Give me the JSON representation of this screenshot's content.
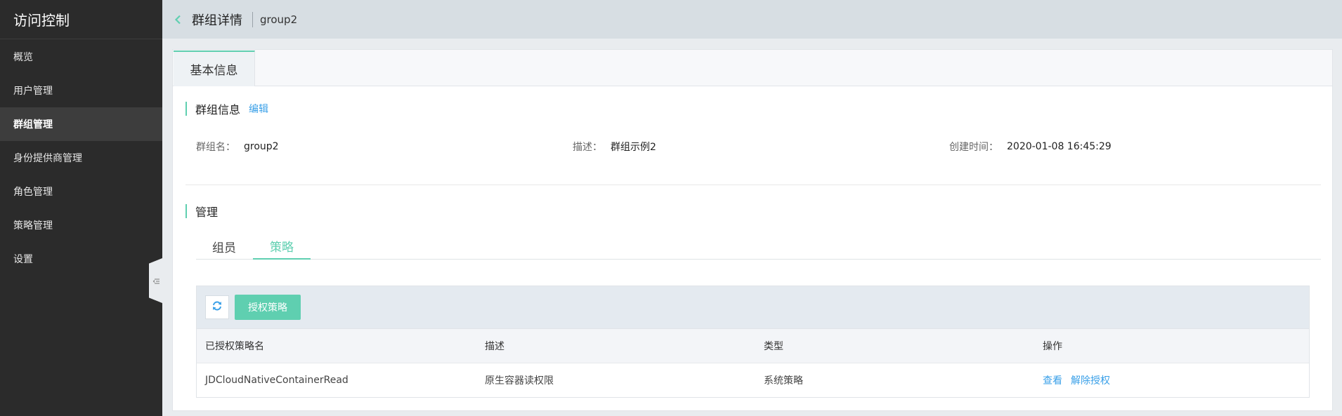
{
  "sidebar": {
    "title": "访问控制",
    "items": [
      {
        "label": "概览"
      },
      {
        "label": "用户管理"
      },
      {
        "label": "群组管理"
      },
      {
        "label": "身份提供商管理"
      },
      {
        "label": "角色管理"
      },
      {
        "label": "策略管理"
      },
      {
        "label": "设置"
      }
    ],
    "active_index": 2
  },
  "header": {
    "title": "群组详情",
    "subtitle": "group2"
  },
  "top_tabs": [
    {
      "label": "基本信息"
    }
  ],
  "group_info": {
    "section_title": "群组信息",
    "edit_label": "编辑",
    "name_label": "群组名：",
    "name_value": "group2",
    "desc_label": "描述：",
    "desc_value": "群组示例2",
    "created_label": "创建时间：",
    "created_value": "2020-01-08 16:45:29"
  },
  "manage": {
    "section_title": "管理",
    "tabs": [
      {
        "label": "组员"
      },
      {
        "label": "策略"
      }
    ],
    "active_tab": 1,
    "grant_button": "授权策略",
    "columns": [
      "已授权策略名",
      "描述",
      "类型",
      "操作"
    ],
    "rows": [
      {
        "name": "JDCloudNativeContainerRead",
        "desc": "原生容器读权限",
        "type": "系统策略",
        "actions": [
          "查看",
          "解除授权"
        ]
      }
    ]
  },
  "icons": {
    "back": "chevron-left-icon",
    "refresh": "refresh-icon",
    "collapse": "collapse-sidebar-icon"
  },
  "colors": {
    "accent": "#5fcfb0",
    "link": "#3aa0e8",
    "sidebar_bg": "#2b2b2b"
  }
}
